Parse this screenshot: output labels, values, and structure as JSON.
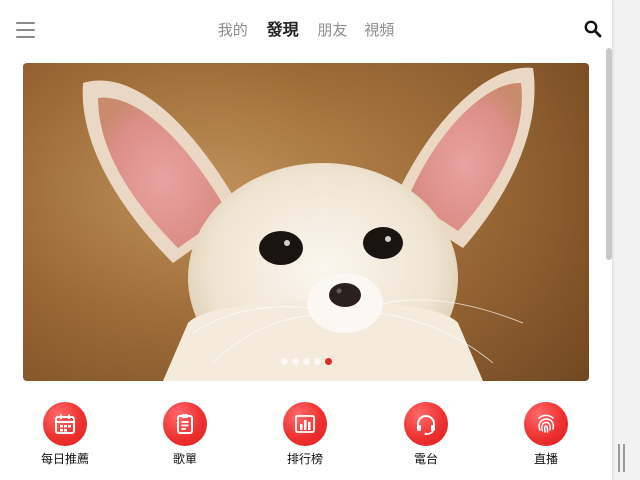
{
  "header": {
    "tabs": [
      {
        "label": "我的",
        "active": false
      },
      {
        "label": "發現",
        "active": true
      },
      {
        "label": "朋友",
        "active": false
      },
      {
        "label": "視頻",
        "active": false
      }
    ],
    "menu_icon": "hamburger-menu-icon",
    "search_icon": "search-icon"
  },
  "banner": {
    "image_subject": "fennec fox",
    "indicator_count": 5,
    "active_indicator": 5
  },
  "quick_menu": [
    {
      "label": "每日推薦",
      "icon": "calendar-icon"
    },
    {
      "label": "歌單",
      "icon": "clipboard-icon"
    },
    {
      "label": "排行榜",
      "icon": "bar-chart-icon"
    },
    {
      "label": "電台",
      "icon": "headset-icon"
    },
    {
      "label": "直播",
      "icon": "fingerprint-icon"
    }
  ],
  "colors": {
    "accent": "#ee3030",
    "active_tab": "#222222",
    "inactive_tab": "#8e8e8e"
  }
}
